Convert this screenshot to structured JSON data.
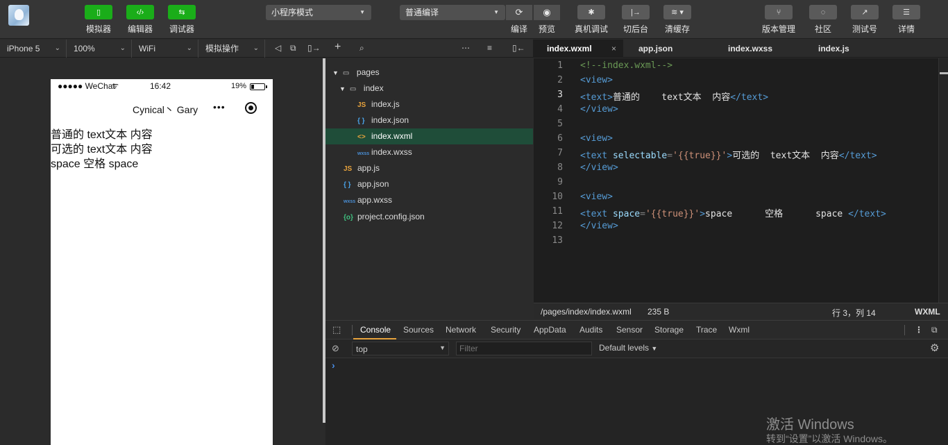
{
  "toolbar": {
    "left_buttons": [
      {
        "label": "模拟器",
        "icon": "phone-icon"
      },
      {
        "label": "编辑器",
        "icon": "code-icon"
      },
      {
        "label": "调试器",
        "icon": "debug-icon"
      }
    ],
    "mode_select": "小程序模式",
    "compile_select": "普通编译",
    "compile_label": "编译",
    "preview_label": "预览",
    "middle_buttons": [
      {
        "label": "真机调试",
        "icon": "bug-icon"
      },
      {
        "label": "切后台",
        "icon": "switch-icon"
      },
      {
        "label": "清缓存",
        "icon": "layers-icon"
      }
    ],
    "right_buttons": [
      {
        "label": "版本管理",
        "icon": "branch-icon"
      },
      {
        "label": "社区",
        "icon": "chat-icon"
      },
      {
        "label": "测试号",
        "icon": "share-icon"
      },
      {
        "label": "详情",
        "icon": "menu-icon"
      }
    ]
  },
  "simulator_bar": {
    "device": "iPhone 5",
    "zoom": "100%",
    "network": "WiFi",
    "operation": "模拟操作"
  },
  "phone": {
    "status_left": "●●●●● WeChat",
    "time": "16:42",
    "battery": "19%",
    "nav_title": "Cynical丶 Gary",
    "nav_dots": "•••",
    "lines": [
      "普通的 text文本 内容",
      "可选的 text文本 内容",
      "space 空格 space"
    ]
  },
  "file_tree": [
    {
      "name": "pages",
      "type": "folder",
      "level": 0
    },
    {
      "name": "index",
      "type": "folder",
      "level": 1
    },
    {
      "name": "index.js",
      "type": "js",
      "level": 2
    },
    {
      "name": "index.json",
      "type": "json",
      "level": 2
    },
    {
      "name": "index.wxml",
      "type": "wxml",
      "level": 2,
      "selected": true
    },
    {
      "name": "index.wxss",
      "type": "wxss",
      "level": 2
    },
    {
      "name": "app.js",
      "type": "js",
      "level": 1
    },
    {
      "name": "app.json",
      "type": "json",
      "level": 1
    },
    {
      "name": "app.wxss",
      "type": "wxss",
      "level": 1
    },
    {
      "name": "project.config.json",
      "type": "config",
      "level": 1
    }
  ],
  "editor_tabs": [
    "index.wxml",
    "app.json",
    "index.wxss",
    "index.js"
  ],
  "code": {
    "line_numbers": [
      "1",
      "2",
      "3",
      "4",
      "5",
      "6",
      "7",
      "8",
      "9",
      "10",
      "11",
      "12",
      "13"
    ],
    "l1": "<!--index.wxml-->",
    "view_open": "<view>",
    "view_close": "</view>",
    "text_open": "<text",
    "text_close": "</text>",
    "gt": ">",
    "attr_selectable": "selectable",
    "attr_space": "space",
    "eq": "=",
    "val_true": "'{{true}}'",
    "l3_text": "普通的    text文本  内容",
    "l7_text": "可选的  text文本  内容",
    "l11_text": "space      空格      space "
  },
  "editor_status": {
    "path": "/pages/index/index.wxml",
    "size": "235 B",
    "cursor": "行 3，列 14",
    "lang": "WXML"
  },
  "devtools": {
    "tabs": [
      "Console",
      "Sources",
      "Network",
      "Security",
      "AppData",
      "Audits",
      "Sensor",
      "Storage",
      "Trace",
      "Wxml"
    ],
    "context": "top",
    "filter_placeholder": "Filter",
    "levels": "Default levels",
    "prompt": "›"
  },
  "watermark": {
    "line1": "激活 Windows",
    "line2": "转到“设置”以激活 Windows。"
  },
  "colors": {
    "accent_green": "#1aad19",
    "selected_row": "#1f4d39",
    "console_active": "#e8a33d"
  }
}
